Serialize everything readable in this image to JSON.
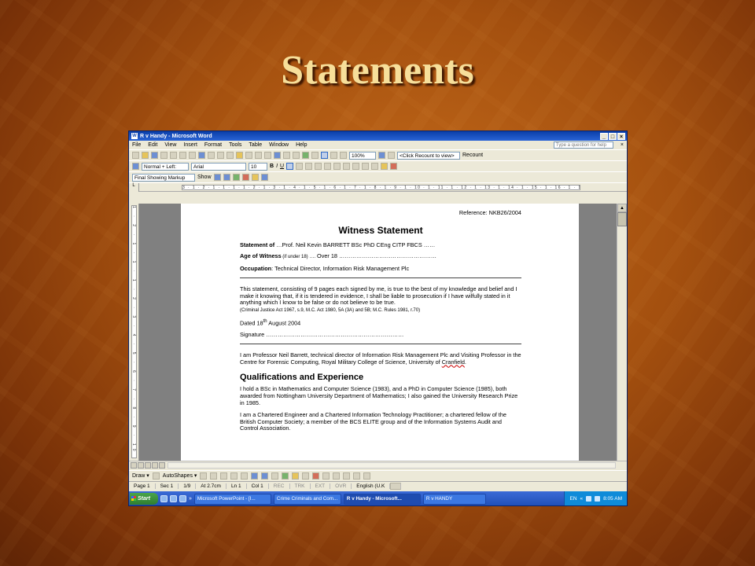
{
  "slide": {
    "title": "Statements"
  },
  "window": {
    "title": "R v Handy - Microsoft Word",
    "controls": {
      "minimize": "_",
      "maximize": "□",
      "close": "×"
    }
  },
  "menu": {
    "items": [
      "File",
      "Edit",
      "View",
      "Insert",
      "Format",
      "Tools",
      "Table",
      "Window",
      "Help"
    ],
    "help_placeholder": "Type a question for help",
    "close_doc": "×"
  },
  "toolbar": {
    "zoom": "100%",
    "recount": "<Click Recount to view>",
    "recount_btn": "Recount",
    "style": "Normal + Left:",
    "font": "Arial",
    "size": "10",
    "bold": "B",
    "italic": "I",
    "underline": "U",
    "markup": "Final Showing Markup",
    "show": "Show"
  },
  "ruler": {
    "ticks": "3 · 1 · 2 · 1 · 1 · 1 · 1 · 2 · 1 · 3 · 1 · 4 · 1 · 5 · 1 · 6 · 1 · 7 · 1 · 8 · 1 · 9 · 1 · 10 · 1 · 11 · 1 · 12 · 1 · 13 · 1 · 14 · 1 · 15 · 1 · 16 · 1 · 17 · 1 · 18"
  },
  "vruler": {
    "ticks": "1 · 2 · 1 · 1 · 1 · 2 · 3 · 4 · 5 · 6 · 7 · 8 · 9 · 10 · 11 · 12 · 13"
  },
  "doc": {
    "reference": "Reference: NKB26/2004",
    "heading": "Witness Statement",
    "statement_of_label": "Statement of",
    "statement_of_value": " …Prof. Neil Kevin BARRETT BSc PhD CEng CITP FBCS ……",
    "age_label": "Age of Witness",
    "age_note": " (if under 18) ….",
    "age_value": " Over 18 ……………………………………………",
    "occupation_label": "Occupation",
    "occupation_value": ": Technical Director, Information Risk Management Plc",
    "declaration": "This statement, consisting of 9 pages each signed by me, is true to the best of my knowledge and belief and I make it knowing that, if it is tendered in evidence, I shall be liable to prosecution if I have wilfully stated in it anything which I know to be false or do not believe to be true.",
    "act_ref": "(Criminal Justice Act 1967, s.9, M.C. Act 1980, 5A (3A) and 5B; M.C. Rules 1981, r.70)",
    "dated_prefix": "Dated 18",
    "dated_sup": "th",
    "dated_suffix": " August 2004",
    "signature": "Signature ………………………………………………………………",
    "intro_text": "I am Professor Neil Barrett, technical director of Information Risk Management Plc and Visiting Professor in the Centre for Forensic Computing, Royal Military College of Science, University of ",
    "intro_place": "Cranfield",
    "intro_end": ".",
    "qual_heading": "Qualifications and Experience",
    "qual_p1": "I hold a BSc in Mathematics and Computer Science (1983), and a PhD in Computer Science (1985), both awarded from Nottingham University Department of Mathematics; I also gained the University Research Prize in 1985.",
    "qual_p2": "I am a Chartered Engineer and a Chartered Information Technology Practitioner; a chartered fellow of the British Computer Society; a member of the BCS ELITE group and of the Information Systems Audit and Control Association."
  },
  "drawbar": {
    "draw": "Draw ▾",
    "autoshapes": "AutoShapes ▾"
  },
  "status": {
    "page": "Page 1",
    "sec": "Sec 1",
    "pages": "1/9",
    "at": "At 2.7cm",
    "ln": "Ln 1",
    "col": "Col 1",
    "rec": "REC",
    "trk": "TRK",
    "ext": "EXT",
    "ovr": "OVR",
    "lang": "English (U.K"
  },
  "taskbar": {
    "start": "Start",
    "more": "»",
    "tasks": [
      "Microsoft PowerPoint - [I...",
      "Crime Criminals and Com...",
      "R v Handy - Microsoft...",
      "R v HANDY"
    ],
    "tray_lang": "EN",
    "tray_more": "«",
    "time": "8:05 AM"
  }
}
